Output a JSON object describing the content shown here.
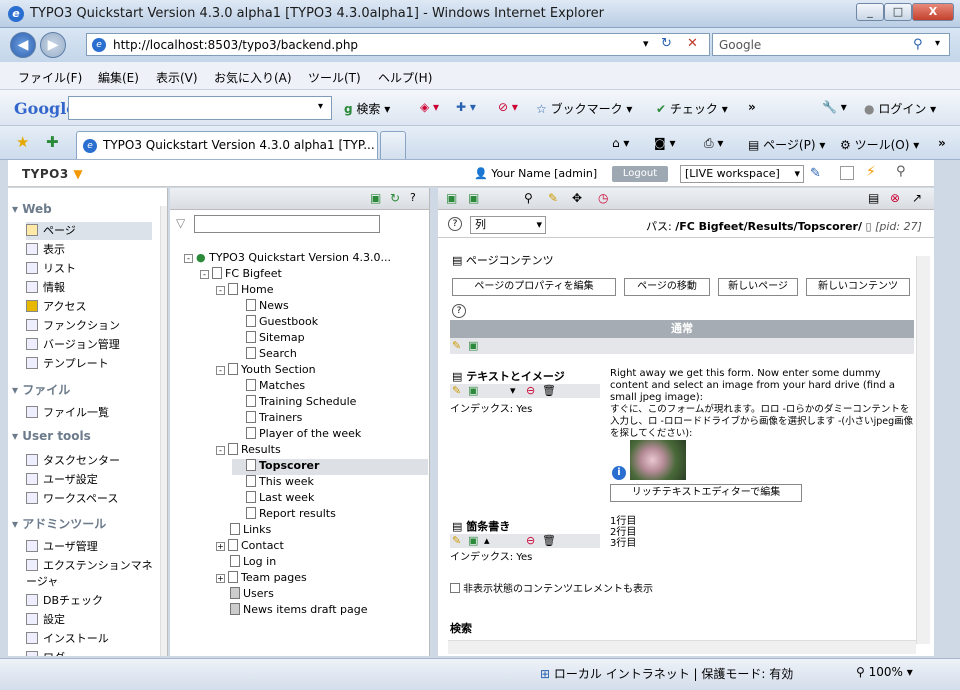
{
  "window": {
    "title": "TYPO3 Quickstart Version 4.3.0 alpha1 [TYPO3 4.3.0alpha1] - Windows Internet Explorer",
    "minimize": "_",
    "maximize": "□",
    "close": "X"
  },
  "browser": {
    "url": "http://localhost:8503/typo3/backend.php",
    "search_placeholder": "Google",
    "back": "◀",
    "forward": "▶"
  },
  "menubar": [
    "ファイル(F)",
    "編集(E)",
    "表示(V)",
    "お気に入り(A)",
    "ツール(T)",
    "ヘルプ(H)"
  ],
  "googlebar": {
    "logo": "Google",
    "search": "検索",
    "bookmarks": "ブックマーク",
    "check": "チェック",
    "login": "ログイン"
  },
  "tab": {
    "title": "TYPO3 Quickstart Version 4.3.0 alpha1 [TYP...",
    "page": "ページ(P)",
    "tools": "ツール(O)"
  },
  "typo3": {
    "logo": "TYPO3",
    "user": "Your Name [admin]",
    "logout": "Logout",
    "workspace": "[LIVE workspace]"
  },
  "modules": [
    {
      "header": "Web",
      "items": [
        "ページ",
        "表示",
        "リスト",
        "情報",
        "アクセス",
        "ファンクション",
        "バージョン管理",
        "テンプレート"
      ]
    },
    {
      "header": "ファイル",
      "items": [
        "ファイル一覧"
      ]
    },
    {
      "header": "User tools",
      "items": [
        "タスクセンター",
        "ユーザ設定",
        "ワークスペース"
      ]
    },
    {
      "header": "アドミンツール",
      "items": [
        "ユーザ管理",
        "エクステンションマネージャ",
        "DBチェック",
        "設定",
        "インストール",
        "ログ"
      ]
    }
  ],
  "tree": {
    "root": "TYPO3 Quickstart Version 4.3.0...",
    "nodes": [
      "FC Bigfeet",
      "Home",
      "News",
      "Guestbook",
      "Sitemap",
      "Search",
      "Youth Section",
      "Matches",
      "Training Schedule",
      "Trainers",
      "Player of the week",
      "Results",
      "Topscorer",
      "This week",
      "Last week",
      "Report results",
      "Links",
      "Contact",
      "Log in",
      "Team pages",
      "Users",
      "News items draft page"
    ]
  },
  "content": {
    "column_select": "列",
    "path_label": "パス:",
    "path": "/FC Bigfeet/Results/Topscorer/",
    "pid": "[pid: 27]",
    "section_title": "ページコンテンツ",
    "buttons": [
      "ページのプロパティを編集",
      "ページの移動",
      "新しいページ",
      "新しいコンテンツ"
    ],
    "column_header": "通常",
    "element1": {
      "type": "テキストとイメージ",
      "index": "インデックス: Yes",
      "text_en": "Right away we get this form. Now enter some dummy content and select an image from your hard drive (find a small jpeg image):",
      "text_ja": "すぐに、このフォームが現れます。ロロ -ロらかのダミーコンテントを入力し、ロ -ロロードドライブから画像を選択します -(小さいjpeg画像を探してください):",
      "rte_button": "リッチテキストエディターで編集"
    },
    "element2": {
      "type": "箇条書き",
      "index": "インデックス: Yes",
      "lines": [
        "1行目",
        "2行目",
        "3行目"
      ]
    },
    "hidden_checkbox": "非表示状態のコンテンツエレメントも表示",
    "search_label": "検索"
  },
  "status": {
    "zone": "ローカル イントラネット | 保護モード: 有効",
    "zoom": "100%"
  }
}
